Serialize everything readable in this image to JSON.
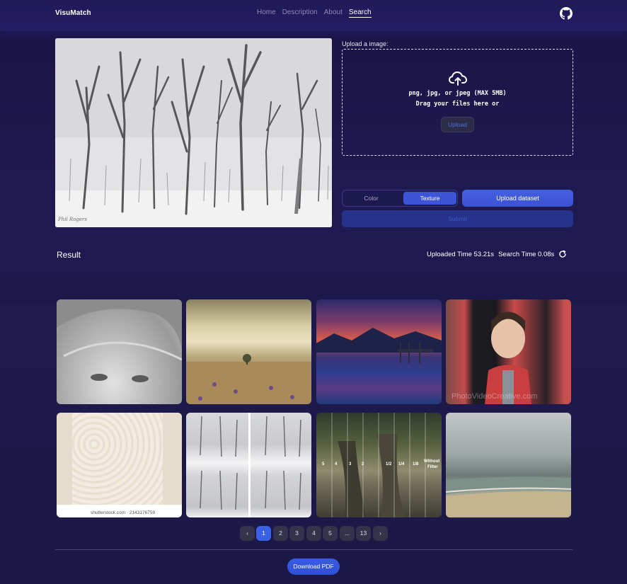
{
  "navbar": {
    "brand": "VisuMatch",
    "links": [
      "Home",
      "Description",
      "About",
      "Search"
    ],
    "active": "Search",
    "github_icon": "github-icon"
  },
  "upload": {
    "label": "Upload a image:",
    "formats": "png, jpg, or jpeg (MAX 5MB)",
    "drag_text": "Drag your files here or",
    "upload_button": "Upload",
    "cloud_icon": "cloud-upload-icon"
  },
  "preview": {
    "signature": "Phil Rogers"
  },
  "controls": {
    "toggle_options": [
      "Color",
      "Texture"
    ],
    "selected_option": "Texture",
    "upload_dataset_button": "Upload dataset",
    "submit_button": "Submit"
  },
  "result": {
    "title": "Result",
    "uploaded_time": "Uploaded Time 53.21s",
    "search_time": "Search Time 0.08s",
    "refresh_icon": "refresh-icon",
    "tiles": [
      {
        "alt": "woman-portrait"
      },
      {
        "alt": "field-clouds"
      },
      {
        "alt": "sunset-lake"
      },
      {
        "alt": "girl-portrait",
        "watermark": "PhotoVideoCreative.com"
      },
      {
        "alt": "dots-texture",
        "watermark": "shutterstock.com · 2143176759"
      },
      {
        "alt": "snow-trees-comparison"
      },
      {
        "alt": "trees-park",
        "overlay_text": "Without Filter",
        "overlay_fractions": [
          "5",
          "4",
          "3",
          "2",
          "1/2",
          "1/4",
          "1/8"
        ]
      },
      {
        "alt": "beach-painting"
      }
    ]
  },
  "pagination": {
    "prev": "‹",
    "pages": [
      "1",
      "2",
      "3",
      "4",
      "5",
      "...",
      "13"
    ],
    "current": "1",
    "next": "›"
  },
  "footer": {
    "download_pdf": "Download PDF"
  },
  "colors": {
    "accent": "#3b62e6",
    "background": "#1d1849",
    "navbar": "#211c5d"
  }
}
